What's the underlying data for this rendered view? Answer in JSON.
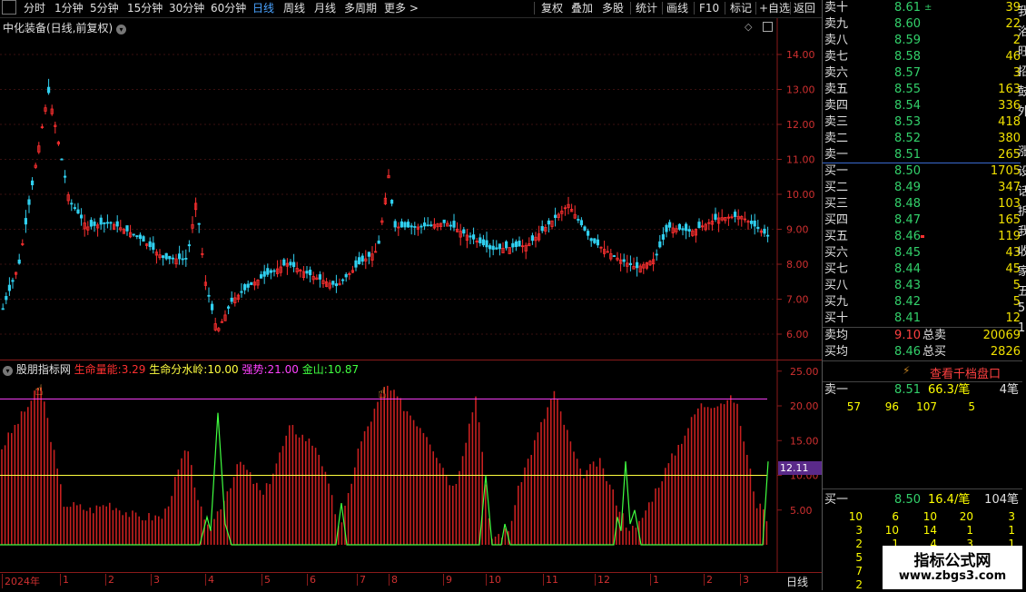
{
  "toolbar": {
    "items": [
      "分时",
      "1分钟",
      "5分钟",
      "15分钟",
      "30分钟",
      "60分钟",
      "日线",
      "周线",
      "月线",
      "多周期",
      "更多"
    ],
    "right_items": [
      "复权",
      "叠加",
      "多股",
      "统计",
      "画线",
      "F10",
      "标记",
      "+自选",
      "返回"
    ],
    "active": "日线"
  },
  "main_chart": {
    "title": "中化装备(日线,前复权)",
    "y_ticks": [
      "14.00",
      "13.00",
      "12.00",
      "11.00",
      "10.00",
      "9.00",
      "8.00",
      "7.00",
      "6.00"
    ]
  },
  "indicator": {
    "name": "股朋指标网",
    "items": [
      {
        "label": "生命量能:",
        "value": "3.29",
        "color": "#ff3030"
      },
      {
        "label": "生命分水岭:",
        "value": "10.00",
        "color": "#ffff40"
      },
      {
        "label": "强势:",
        "value": "21.00",
        "color": "#ff40ff"
      },
      {
        "label": "金山:",
        "value": "10.87",
        "color": "#40ff40"
      }
    ],
    "y_ticks": [
      "25.00",
      "20.00",
      "15.00",
      "10.00",
      "5.00"
    ],
    "current_value": "12.11"
  },
  "x_axis": {
    "labels": [
      "2024年",
      "1",
      "2",
      "3",
      "4",
      "5",
      "6",
      "7",
      "8",
      "9",
      "10",
      "11",
      "12",
      "1",
      "2",
      "3"
    ],
    "period": "日线"
  },
  "order_book": {
    "asks": [
      {
        "label": "卖十",
        "price": "8.61",
        "vol": "39",
        "mark": "±"
      },
      {
        "label": "卖九",
        "price": "8.60",
        "vol": "22"
      },
      {
        "label": "卖八",
        "price": "8.59",
        "vol": "2"
      },
      {
        "label": "卖七",
        "price": "8.58",
        "vol": "46"
      },
      {
        "label": "卖六",
        "price": "8.57",
        "vol": "3"
      },
      {
        "label": "卖五",
        "price": "8.55",
        "vol": "163"
      },
      {
        "label": "卖四",
        "price": "8.54",
        "vol": "336"
      },
      {
        "label": "卖三",
        "price": "8.53",
        "vol": "418"
      },
      {
        "label": "卖二",
        "price": "8.52",
        "vol": "380"
      },
      {
        "label": "卖一",
        "price": "8.51",
        "vol": "265"
      }
    ],
    "bids": [
      {
        "label": "买一",
        "price": "8.50",
        "vol": "1705"
      },
      {
        "label": "买二",
        "price": "8.49",
        "vol": "347"
      },
      {
        "label": "买三",
        "price": "8.48",
        "vol": "103"
      },
      {
        "label": "买四",
        "price": "8.47",
        "vol": "165"
      },
      {
        "label": "买五",
        "price": "8.46",
        "vol": "119"
      },
      {
        "label": "买六",
        "price": "8.45",
        "vol": "43"
      },
      {
        "label": "买七",
        "price": "8.44",
        "vol": "45"
      },
      {
        "label": "买八",
        "price": "8.43",
        "vol": "5"
      },
      {
        "label": "买九",
        "price": "8.42",
        "vol": "5"
      },
      {
        "label": "买十",
        "price": "8.41",
        "vol": "12"
      }
    ],
    "avg_sell_label": "卖均",
    "avg_sell": "9.10",
    "total_sell_label": "总卖",
    "total_sell": "20069",
    "avg_buy_label": "买均",
    "avg_buy": "8.46",
    "total_buy_label": "总买",
    "total_buy": "2826",
    "depth_button": "查看千档盘口",
    "sell1": {
      "label": "卖一",
      "price": "8.51",
      "per": "66.3/笔",
      "count": "4笔",
      "ticks": [
        "57",
        "96",
        "107",
        "5"
      ]
    },
    "buy1": {
      "label": "买一",
      "price": "8.50",
      "per": "16.4/笔",
      "count": "104笔",
      "ticks": [
        [
          "10",
          "6",
          "10",
          "20",
          "3"
        ],
        [
          "3",
          "10",
          "14",
          "1",
          "1"
        ],
        [
          "2",
          "1",
          "4",
          "3",
          "1"
        ],
        [
          "5",
          "",
          "",
          "",
          ""
        ],
        [
          "7",
          "",
          "",
          "",
          ""
        ],
        [
          "2",
          "",
          "",
          "",
          ""
        ]
      ]
    }
  },
  "side_chars": [
    "我",
    "浴",
    "旺",
    "招",
    "鼓",
    "外",
    "",
    "涨",
    "设",
    "话",
    "拆",
    "我",
    "收",
    "家",
    "五",
    "5",
    "1"
  ],
  "watermark": {
    "title": "指标公式网",
    "url": "www.zbgs3.com"
  }
}
